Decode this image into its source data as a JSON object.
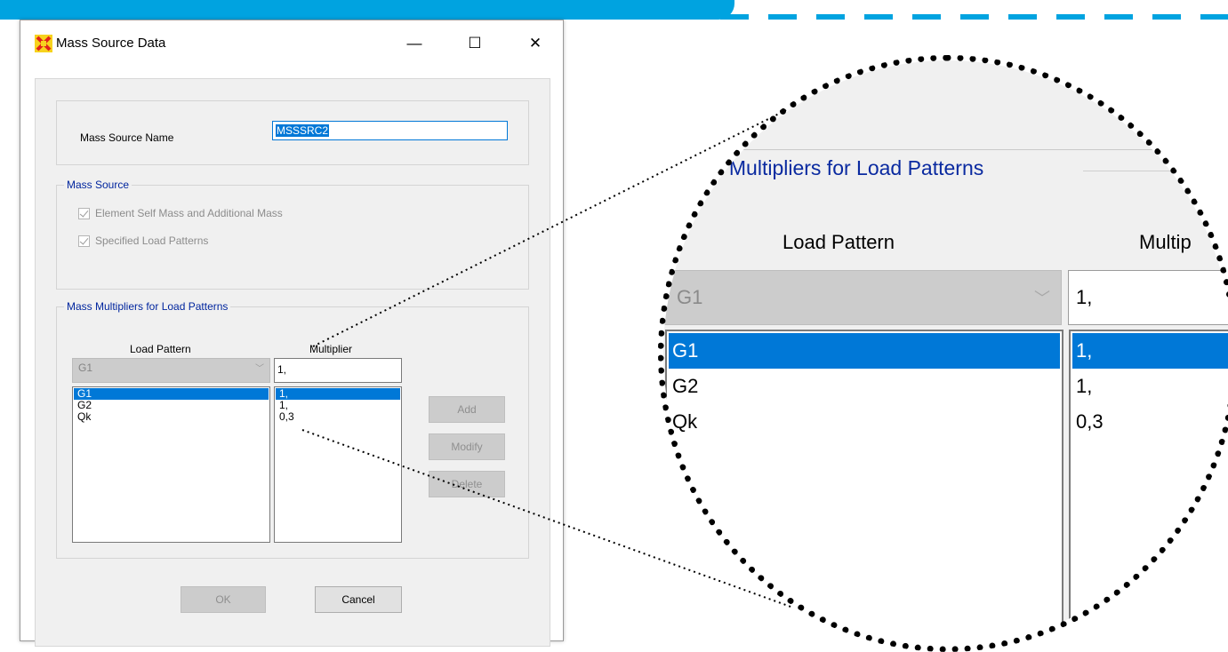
{
  "dialog": {
    "title": "Mass Source Data",
    "window_controls": {
      "minimize": "—",
      "maximize": "☐",
      "close": "✕"
    }
  },
  "mass_source_name": {
    "label": "Mass Source Name",
    "value": "MSSSRC2"
  },
  "mass_source_group": {
    "title": "Mass Source",
    "options": [
      {
        "label": "Element Self Mass and Additional Mass",
        "checked": true,
        "enabled": false
      },
      {
        "label": "Specified Load Patterns",
        "checked": true,
        "enabled": false
      }
    ]
  },
  "multipliers_group": {
    "title": "Mass Multipliers for Load Patterns",
    "load_pattern_header": "Load Pattern",
    "multiplier_header": "Multiplier",
    "combo_value": "G1",
    "multiplier_input": "1,",
    "load_patterns": [
      "G1",
      "G2",
      "Qk"
    ],
    "multipliers": [
      "1,",
      "1,",
      "0,3"
    ],
    "selected_index": 0,
    "add_button": "Add",
    "modify_button": "Modify",
    "delete_button": "Delete"
  },
  "footer": {
    "ok": "OK",
    "cancel": "Cancel"
  },
  "zoom": {
    "title": "s Multipliers for Load Patterns",
    "load_pattern_header": "Load Pattern",
    "multiplier_header": "Multip",
    "combo_value": "G1",
    "multiplier_input": "1,",
    "load_patterns": [
      "G1",
      "G2",
      "Qk"
    ],
    "multipliers": [
      "1,",
      "1,",
      "0,3"
    ]
  },
  "colors": {
    "accent": "#00a3e0",
    "selection": "#0078d7",
    "group_title": "#00259e"
  }
}
